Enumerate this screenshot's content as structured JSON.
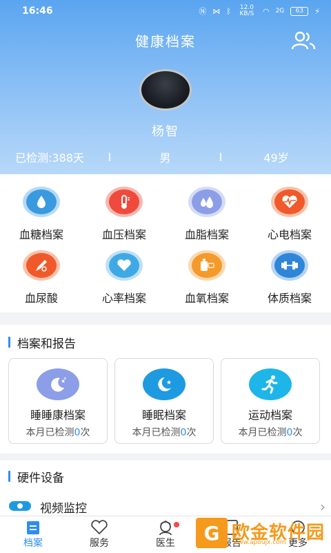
{
  "status_bar": {
    "time": "16:46",
    "net_speed": "12.0 KB/S",
    "signal": "2G",
    "battery": "63"
  },
  "header": {
    "title": "健康档案",
    "members_icon": "users-icon"
  },
  "profile": {
    "name": "杨智",
    "days_label": "已检测:388天",
    "gender": "男",
    "age": "49岁"
  },
  "archive_grid": [
    {
      "label": "血糖档案",
      "icon": "blood-drop-icon",
      "color": "#3a9ae0",
      "ring": "#b7d9f5"
    },
    {
      "label": "血压档案",
      "icon": "thermometer-icon",
      "color": "#ef4a3c",
      "ring": "#f7b8b0"
    },
    {
      "label": "血脂档案",
      "icon": "drops-icon",
      "color": "#8c9ee8",
      "ring": "#d6dcf7"
    },
    {
      "label": "心电档案",
      "icon": "ecg-heart-icon",
      "color": "#f05a2a",
      "ring": "#f9c3ad"
    },
    {
      "label": "血尿酸",
      "icon": "pipette-icon",
      "color": "#f05a2a",
      "ring": "#f9c3ad"
    },
    {
      "label": "心率档案",
      "icon": "heart-icon",
      "color": "#3fa9e6",
      "ring": "#bfe0f6"
    },
    {
      "label": "血氧档案",
      "icon": "spo2-icon",
      "color": "#f59a2a",
      "ring": "#fbd8b0"
    },
    {
      "label": "体质档案",
      "icon": "dumbbell-icon",
      "color": "#2f86d8",
      "ring": "#b5d4f2"
    }
  ],
  "reports_section": {
    "title": "档案和报告",
    "cards": [
      {
        "name": "睡睡康档案",
        "prefix": "本月已检测",
        "count": "0",
        "suffix": "次",
        "icon": "moon-stars-icon",
        "color": "#8c9ee8"
      },
      {
        "name": "睡眠档案",
        "prefix": "本月已检测",
        "count": "0",
        "suffix": "次",
        "icon": "moon-star-icon",
        "color": "#1e9ae0"
      },
      {
        "name": "运动档案",
        "prefix": "本月已检测",
        "count": "0",
        "suffix": "次",
        "icon": "runner-icon",
        "color": "#1eb6e8"
      }
    ]
  },
  "hardware_section": {
    "title": "硬件设备",
    "item_label": "视频监控"
  },
  "tabbar": [
    {
      "label": "档案",
      "icon": "archive-icon",
      "active": true
    },
    {
      "label": "服务",
      "icon": "heart-outline-icon",
      "active": false
    },
    {
      "label": "医生",
      "icon": "nurse-icon",
      "active": false,
      "badge": true
    },
    {
      "label": "报告",
      "icon": "report-icon",
      "active": false
    },
    {
      "label": "更多",
      "icon": "more-icon",
      "active": false
    }
  ],
  "watermark": {
    "text": "欧金软件园",
    "url": "www.apoujx.com"
  },
  "colors": {
    "accent": "#2f8df0",
    "header_top": "#5aa5f0",
    "header_bottom": "#b7d8f9"
  }
}
